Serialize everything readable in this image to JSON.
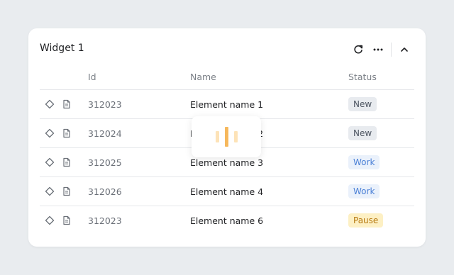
{
  "widget": {
    "title": "Widget 1"
  },
  "toolbar": {
    "icons": [
      "refresh-icon",
      "more-icon",
      "collapse-icon"
    ]
  },
  "table": {
    "columns": {
      "id": "Id",
      "name": "Name",
      "status": "Status"
    },
    "rows": [
      {
        "id": "312023",
        "name": "Element name 1",
        "status": "New",
        "status_kind": "new"
      },
      {
        "id": "312024",
        "name": "Element name 2",
        "status": "New",
        "status_kind": "new"
      },
      {
        "id": "312025",
        "name": "Element name 3",
        "status": "Work",
        "status_kind": "work"
      },
      {
        "id": "312026",
        "name": "Element name 4",
        "status": "Work",
        "status_kind": "work"
      },
      {
        "id": "312023",
        "name": "Element name 6",
        "status": "Pause",
        "status_kind": "pause"
      }
    ]
  },
  "loader": {
    "visible": true
  },
  "colors": {
    "background": "#e9ecef",
    "card": "#ffffff",
    "new": "#e8ebef",
    "work": "#eaf1fb",
    "pause": "#fdf0c4",
    "loader_accent": "#f6b85d"
  }
}
